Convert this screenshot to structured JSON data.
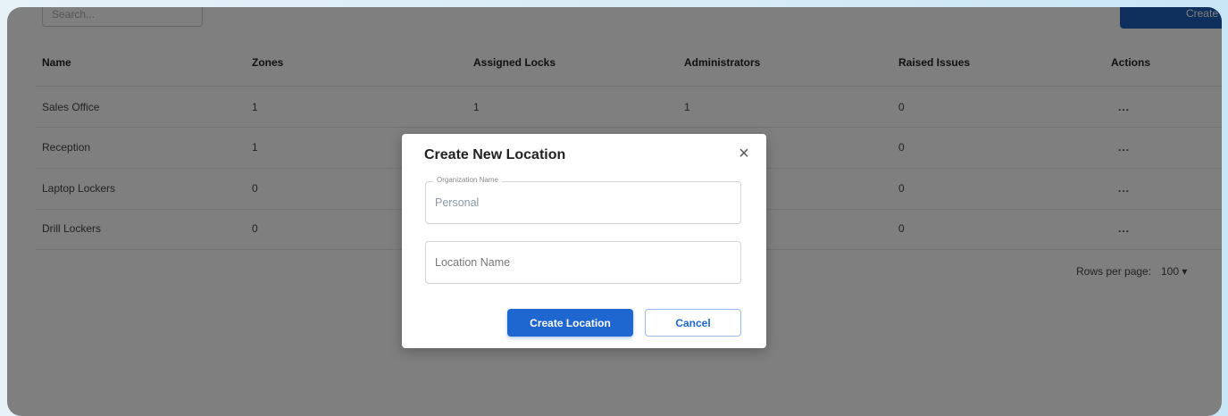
{
  "toolbar": {
    "search_placeholder": "Search...",
    "create_button_label": "Create N"
  },
  "table": {
    "columns": [
      "Name",
      "Zones",
      "Assigned Locks",
      "Administrators",
      "Raised Issues",
      "Actions"
    ],
    "rows": [
      {
        "name": "Sales Office",
        "zones": "1",
        "locks": "1",
        "admins": "1",
        "issues": "0",
        "actions": "..."
      },
      {
        "name": "Reception",
        "zones": "1",
        "locks": "",
        "admins": "",
        "issues": "0",
        "actions": "..."
      },
      {
        "name": "Laptop Lockers",
        "zones": "0",
        "locks": "",
        "admins": "",
        "issues": "0",
        "actions": "..."
      },
      {
        "name": "Drill Lockers",
        "zones": "0",
        "locks": "",
        "admins": "",
        "issues": "0",
        "actions": "..."
      }
    ]
  },
  "pagination": {
    "rows_per_page_label": "Rows per page:",
    "rows_per_page_value": "100 ▾"
  },
  "modal": {
    "title": "Create New Location",
    "close_glyph": "×",
    "org_field": {
      "label": "Organization Name",
      "value": "Personal"
    },
    "location_field": {
      "placeholder": "Location Name"
    },
    "primary_button_label": "Create Location",
    "secondary_button_label": "Cancel"
  },
  "colors": {
    "accent": "#1e66d0",
    "overlay": "rgba(0,0,0,0.5)"
  }
}
